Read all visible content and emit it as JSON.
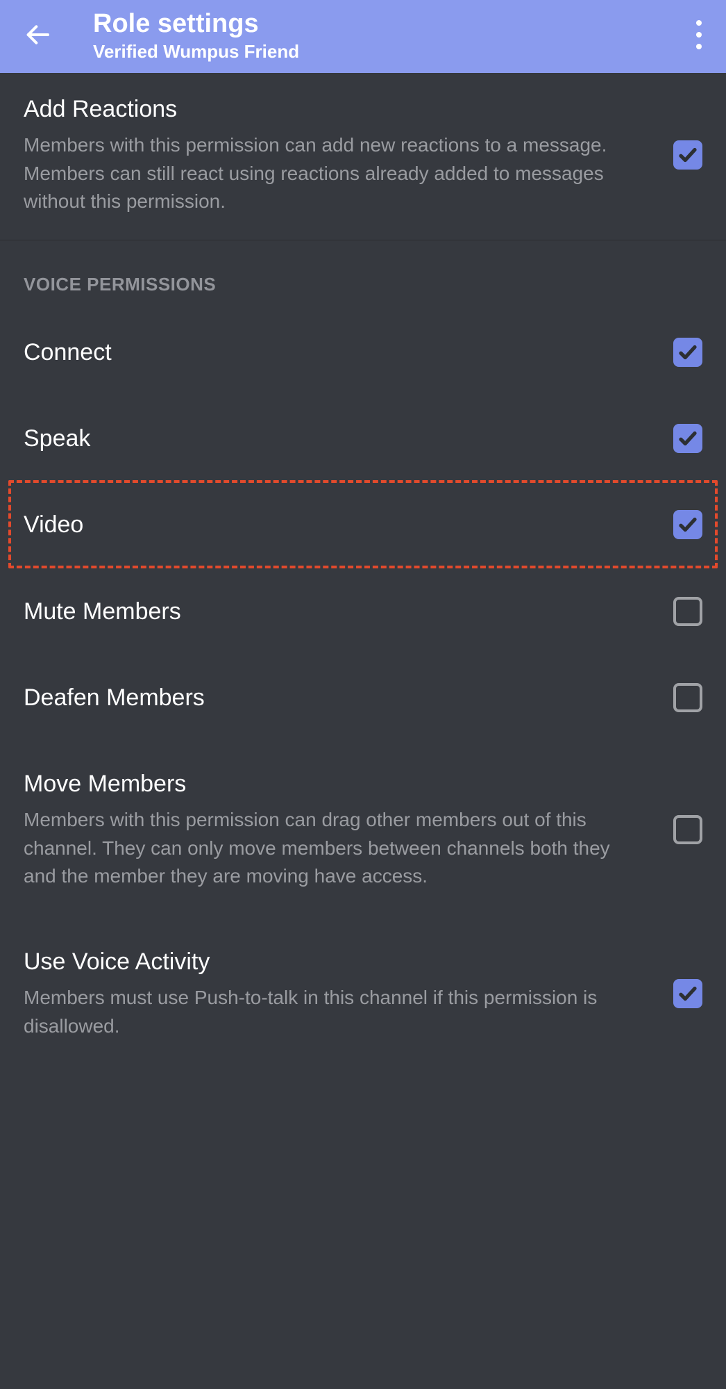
{
  "header": {
    "title": "Role settings",
    "subtitle": "Verified Wumpus Friend"
  },
  "top_permission": {
    "title": "Add Reactions",
    "desc": "Members with this permission can add new reactions to a message. Members can still react using reactions already added to messages without this permission.",
    "checked": true
  },
  "section_title": "VOICE PERMISSIONS",
  "voice_permissions": [
    {
      "title": "Connect",
      "desc": "",
      "checked": true
    },
    {
      "title": "Speak",
      "desc": "",
      "checked": true
    },
    {
      "title": "Video",
      "desc": "",
      "checked": true
    },
    {
      "title": "Mute Members",
      "desc": "",
      "checked": false
    },
    {
      "title": "Deafen Members",
      "desc": "",
      "checked": false
    },
    {
      "title": "Move Members",
      "desc": "Members with this permission can drag other members out of this channel. They can only move members between channels both they and the member they are moving have access.",
      "checked": false
    },
    {
      "title": "Use Voice Activity",
      "desc": "Members must use Push-to-talk in this channel if this permission is disallowed.",
      "checked": true
    }
  ],
  "highlighted_index": 2
}
